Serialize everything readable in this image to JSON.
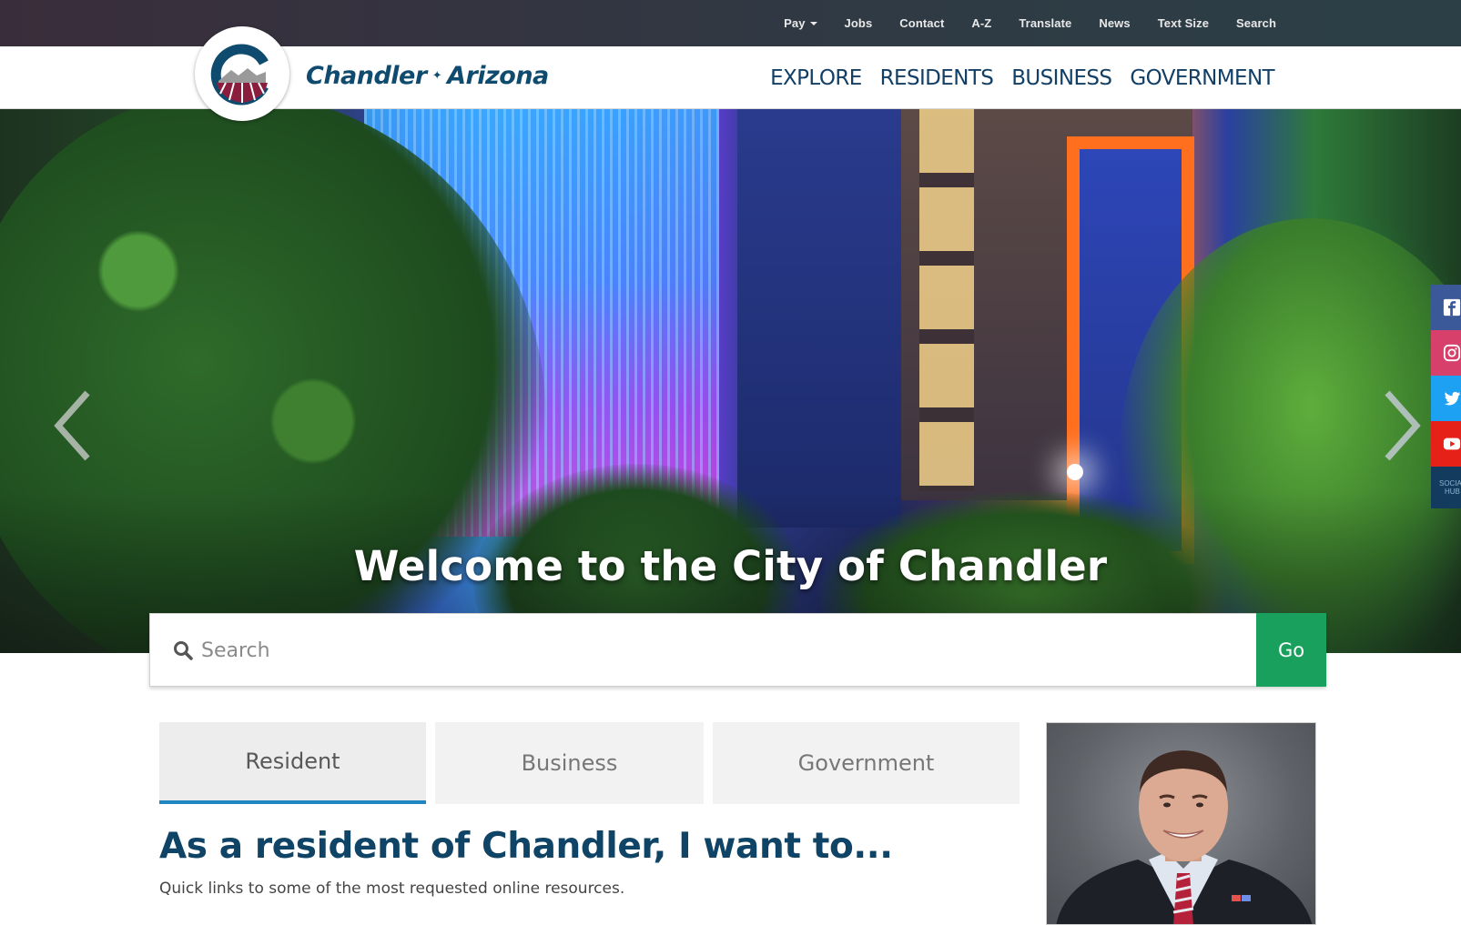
{
  "utility_nav": {
    "items": [
      "Pay",
      "Jobs",
      "Contact",
      "A-Z",
      "Translate",
      "News",
      "Text Size",
      "Search"
    ]
  },
  "brand": {
    "name_part1": "Chandler",
    "separator": "✦",
    "name_part2": "Arizona"
  },
  "main_nav": {
    "items": [
      "EXPLORE",
      "RESIDENTS",
      "BUSINESS",
      "GOVERNMENT"
    ]
  },
  "hero": {
    "title": "Welcome to the City of Chandler"
  },
  "search": {
    "placeholder": "Search",
    "value": "",
    "button_label": "Go"
  },
  "social": {
    "items": [
      "facebook-icon",
      "instagram-icon",
      "twitter-icon",
      "youtube-icon"
    ],
    "hub_label_line1": "SOCIAL",
    "hub_label_line2": "HUB"
  },
  "tabs": {
    "items": [
      "Resident",
      "Business",
      "Government"
    ],
    "active": "Resident"
  },
  "content": {
    "heading": "As a resident of Chandler, I want to...",
    "subheading": "Quick links to some of the most requested online resources."
  },
  "colors": {
    "brand_navy": "#0f4b6e",
    "go_button": "#19a05d",
    "tab_active_underline": "#1f86c2",
    "facebook": "#3b5998",
    "instagram": "#d6406b",
    "twitter": "#1da1f2",
    "youtube": "#e62117",
    "seal_maroon": "#8b1e3f"
  }
}
